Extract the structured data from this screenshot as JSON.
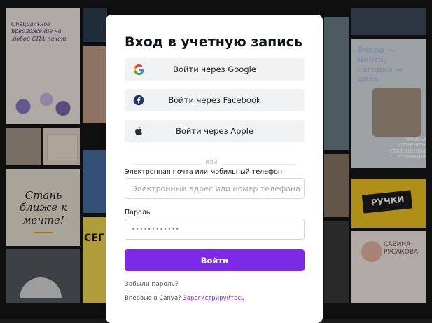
{
  "background": {
    "tile_texts": {
      "poster_handwritten": "Специальное предложение на любой СПА-пакет",
      "poster_vchera": "Вчера — мечта, сегодня — цель",
      "poster_stan": "Стань ближе к мечте!",
      "poster_chtoby": "ЧТОБЫ ОТКРЫТЬ СЕБЯ НОВОЙ СТОРОНЫ",
      "poster_ruchki": "РУЧКИ",
      "poster_sabina": "САБИНА РУСАКОВА",
      "poster_ceg": "СЕГ"
    }
  },
  "login": {
    "title": "Вход в учетную запись",
    "sso": [
      {
        "label": "Войти через Google",
        "icon": "google-icon"
      },
      {
        "label": "Войти через Facebook",
        "icon": "facebook-icon"
      },
      {
        "label": "Войти через Apple",
        "icon": "apple-icon"
      }
    ],
    "divider_text": "или",
    "email_label": "Электронная почта или мобильный телефон",
    "email_placeholder": "Электронный адрес или номер телефона",
    "password_label": "Пароль",
    "password_value": "••••••••••••",
    "submit_label": "Войти",
    "forgot_link": "Забыли пароль?",
    "signup_prompt": "Впервые в Canva?",
    "signup_link": "Зарегистрируйтесь"
  },
  "colors": {
    "accent": "#7d2ae8",
    "google_blue": "#4285f4",
    "facebook_blue": "#1877f2"
  }
}
